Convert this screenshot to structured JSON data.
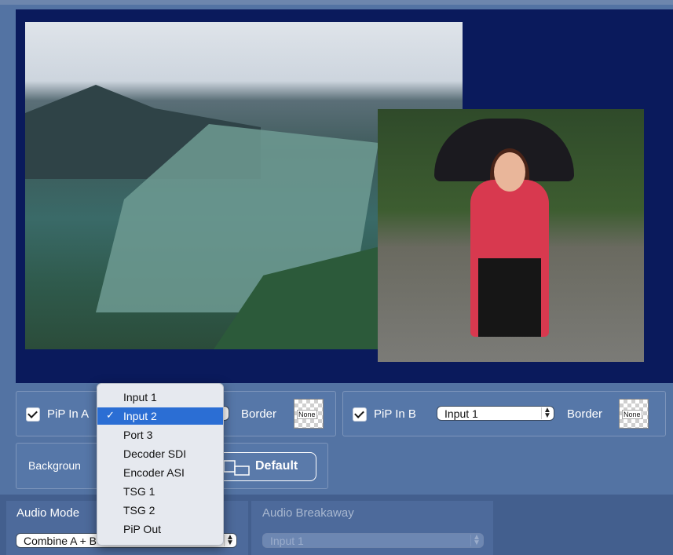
{
  "pip_a": {
    "label": "PiP In A",
    "checked": true,
    "border_label": "Border",
    "border_swatch": "None"
  },
  "pip_b": {
    "label": "PiP In B",
    "checked": true,
    "selected_input": "Input 1",
    "border_label": "Border",
    "border_swatch": "None"
  },
  "background": {
    "label": "Backgroun",
    "button_label": "Default"
  },
  "dropdown": {
    "options": [
      "Input 1",
      "Input 2",
      "Port 3",
      "Decoder SDI",
      "Encoder ASI",
      "TSG 1",
      "TSG 2",
      "PiP Out"
    ],
    "selected": "Input 2"
  },
  "audio": {
    "mode_label": "Audio Mode",
    "mode_value": "Combine A + B",
    "breakaway_label": "Audio Breakaway",
    "breakaway_value": "Input 1"
  },
  "colors": {
    "preview_bg": "#0a1a5c",
    "panel": "#5373a3",
    "menu_highlight": "#2b6ed4"
  }
}
